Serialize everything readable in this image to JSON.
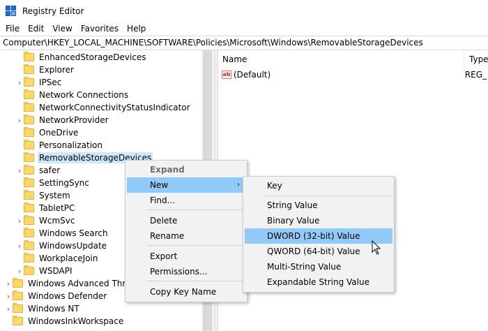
{
  "window": {
    "title": "Registry Editor"
  },
  "menu": [
    "File",
    "Edit",
    "View",
    "Favorites",
    "Help"
  ],
  "address": "Computer\\HKEY_LOCAL_MACHINE\\SOFTWARE\\Policies\\Microsoft\\Windows\\RemovableStorageDevices",
  "tree": {
    "children": [
      {
        "label": "EnhancedStorageDevices",
        "chevron": false
      },
      {
        "label": "Explorer",
        "chevron": false
      },
      {
        "label": "IPSec",
        "chevron": true
      },
      {
        "label": "Network Connections",
        "chevron": false
      },
      {
        "label": "NetworkConnectivityStatusIndicator",
        "chevron": false
      },
      {
        "label": "NetworkProvider",
        "chevron": true
      },
      {
        "label": "OneDrive",
        "chevron": false
      },
      {
        "label": "Personalization",
        "chevron": false
      },
      {
        "label": "RemovableStorageDevices",
        "chevron": false,
        "selected": true
      },
      {
        "label": "safer",
        "chevron": true
      },
      {
        "label": "SettingSync",
        "chevron": false
      },
      {
        "label": "System",
        "chevron": false
      },
      {
        "label": "TabletPC",
        "chevron": false
      },
      {
        "label": "WcmSvc",
        "chevron": true
      },
      {
        "label": "Windows Search",
        "chevron": false
      },
      {
        "label": "WindowsUpdate",
        "chevron": true
      },
      {
        "label": "WorkplaceJoin",
        "chevron": false
      },
      {
        "label": "WSDAPI",
        "chevron": true
      }
    ],
    "siblings": [
      {
        "label": "Windows Advanced Threat",
        "chevron": true
      },
      {
        "label": "Windows Defender",
        "chevron": true
      },
      {
        "label": "Windows NT",
        "chevron": true
      },
      {
        "label": "WindowsInkWorkspace",
        "chevron": false
      }
    ]
  },
  "list": {
    "headers": {
      "name": "Name",
      "type": "Type"
    },
    "rows": [
      {
        "name": "(Default)",
        "type": "REG_"
      }
    ]
  },
  "context_menu": {
    "items": [
      "Expand",
      "New",
      "Find...",
      "Delete",
      "Rename",
      "Export",
      "Permissions...",
      "Copy Key Name"
    ],
    "new_arrow": "›"
  },
  "submenu": {
    "items": [
      "Key",
      "String Value",
      "Binary Value",
      "DWORD (32-bit) Value",
      "QWORD (64-bit) Value",
      "Multi-String Value",
      "Expandable String Value"
    ]
  },
  "colors": {
    "selection": "#cce8ff",
    "menu_highlight": "#91c9f7",
    "menu_bg": "#f2f2f2"
  },
  "icons": {
    "app": "registry-icon",
    "string_value": "ab-string-icon",
    "folder": "folder-icon",
    "pointer": "arrow-pointer-icon"
  }
}
